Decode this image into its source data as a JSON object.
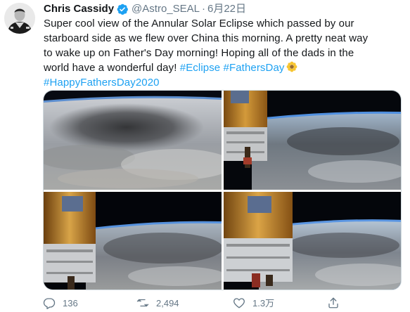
{
  "tweet": {
    "author_name": "Chris Cassidy",
    "handle": "@Astro_SEAL",
    "separator": "·",
    "date": "6月22日",
    "text_lines": [
      "Super cool view of the Annular Solar Eclipse which passed by our",
      "starboard side as we flew over China this morning. A pretty neat way",
      "to wake up on Father's Day morning! Hoping all of the dads in the",
      "world have a wonderful day! "
    ],
    "hashtags": [
      "#Eclipse",
      "#FathersDay",
      "#HappyFathersDay2020"
    ]
  },
  "actions": {
    "reply_count": "136",
    "retweet_count": "2,494",
    "like_count": "1.3万"
  },
  "icons": {
    "verified": "verified-badge-icon",
    "reply": "reply-icon",
    "retweet": "retweet-icon",
    "like": "heart-icon",
    "share": "share-icon"
  },
  "colors": {
    "accent": "#1da1f2",
    "muted": "#657786",
    "text": "#14171a"
  }
}
